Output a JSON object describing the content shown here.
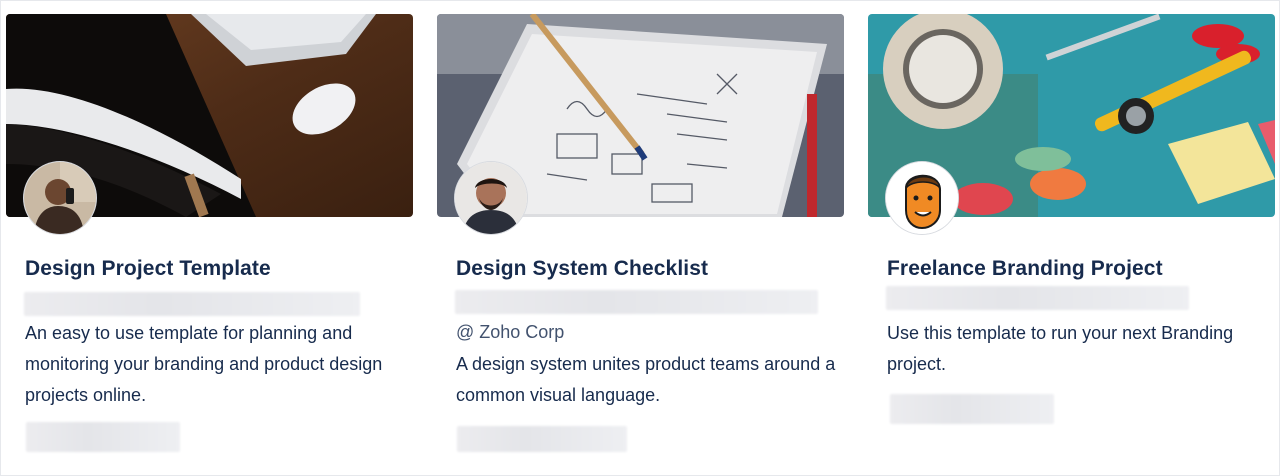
{
  "cards": [
    {
      "title": "Design Project Template",
      "description": "An easy to use template for planning and monitoring your branding and product design projects online.",
      "cover_icon": "desk-laptop-mouse-photo",
      "avatar_icon": "man-on-phone-avatar"
    },
    {
      "title": "Design System Checklist",
      "company": "@ Zoho Corp",
      "description": "A design system unites product teams around a common visual language.",
      "cover_icon": "sketchbook-pencil-photo",
      "avatar_icon": "smiling-man-avatar"
    },
    {
      "title": "Freelance Branding Project",
      "description": "Use this template to run your next Branding project.",
      "cover_icon": "craft-tools-photo",
      "avatar_icon": "cartoon-face-avatar"
    }
  ],
  "colors": {
    "title": "#172b4d",
    "text": "#172b4d",
    "muted": "#42526e",
    "border": "#e6e8ec",
    "avatar_orange": "#f08a24"
  }
}
